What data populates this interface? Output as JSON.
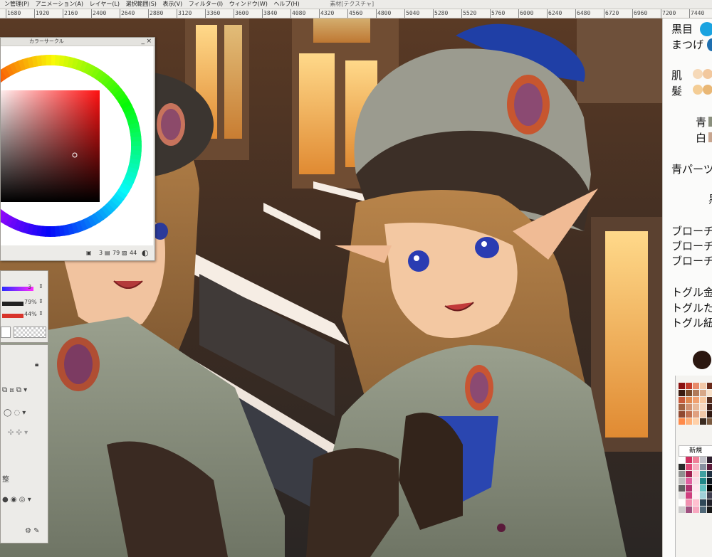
{
  "menubar": {
    "items": [
      "ン管理(P)",
      "アニメーション(A)",
      "レイヤー(L)",
      "選択範囲(S)",
      "表示(V)",
      "フィルター(I)",
      "ウィンドウ(W)",
      "ヘルプ(H)"
    ],
    "material_tab": "素材[テクスチャ]"
  },
  "ruler": {
    "ticks": [
      "1680",
      "1920",
      "2160",
      "2400",
      "2640",
      "2880",
      "3120",
      "3360",
      "3600",
      "3840",
      "4080",
      "4320",
      "4560",
      "4800",
      "5040",
      "5280",
      "5520",
      "5760",
      "6000",
      "6240",
      "6480",
      "6720",
      "6960",
      "7200",
      "7440"
    ]
  },
  "color_circle": {
    "title": "カラーサークル",
    "foot_value_1": "3",
    "foot_value_2": "79",
    "foot_value_3": "44",
    "close_icon": "close-icon",
    "min_icon": "minimize-icon"
  },
  "tool_panel": {
    "value_size": "3",
    "value_opacity_1": "79%",
    "value_opacity_2": "44%",
    "label_bottom": "整"
  },
  "notes": {
    "kuro_me": "黒目",
    "matsuge": "まつげ",
    "hada": "肌",
    "kami": "髪",
    "ao": "青",
    "shiro": "白",
    "ao_parts": "青パーツ",
    "kuro": "黒",
    "brooch_1": "ブローチ",
    "brooch_2": "ブローチ",
    "brooch_3": "ブローチ",
    "toggle_1": "トグル金",
    "toggle_2": "トグルた",
    "toggle_3": "トグル紐"
  },
  "palette": {
    "new_label": "新規"
  },
  "colors": {
    "kuro_me": "#1aa3e0",
    "matsuge": "#1e6fb0",
    "hada_1": "#f6d9b8",
    "hada_2": "#f2c89e",
    "kami_1": "#f4cd95",
    "kami_2": "#e9b775",
    "ao_swatch": "#8a8f7d",
    "shiro_swatch": "#c7a58f",
    "dark_circle": "#2b1710",
    "accent_red": "#d8342b"
  }
}
